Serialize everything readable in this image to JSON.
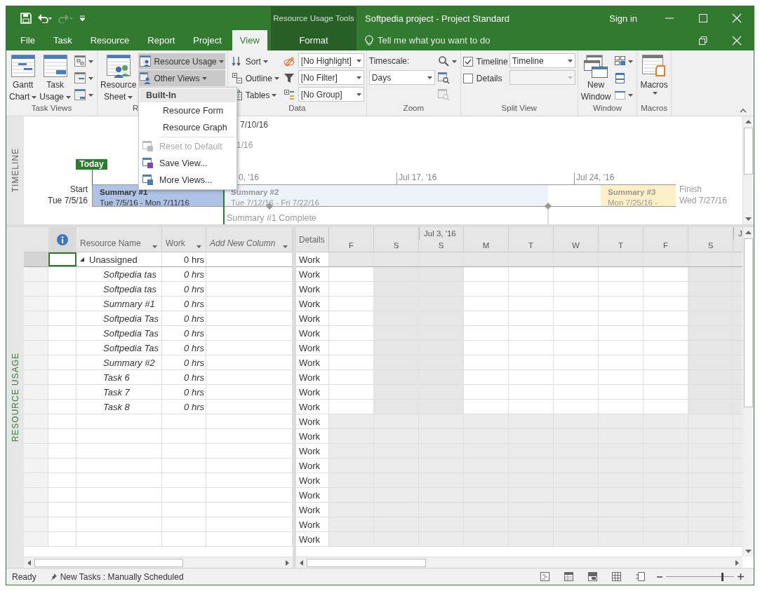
{
  "title_bar": {
    "context": "Resource Usage Tools",
    "title": "Softpedia project - Project Standard",
    "sign_in": "Sign in"
  },
  "tabs": [
    {
      "label": "File",
      "selected": false,
      "kind": "standard"
    },
    {
      "label": "Task",
      "selected": false,
      "kind": "standard"
    },
    {
      "label": "Resource",
      "selected": false,
      "kind": "standard"
    },
    {
      "label": "Report",
      "selected": false,
      "kind": "standard"
    },
    {
      "label": "Project",
      "selected": false,
      "kind": "standard"
    },
    {
      "label": "View",
      "selected": true,
      "kind": "standard"
    },
    {
      "label": "Format",
      "selected": false,
      "kind": "contextual"
    }
  ],
  "tell_me": {
    "placeholder": "Tell me what you want to do"
  },
  "ribbon": [
    {
      "label": "Task Views",
      "label_cut": false,
      "columns": [
        [
          {
            "kind": "large",
            "lines": [
              "Gantt",
              "Chart"
            ],
            "dropdown": true
          }
        ],
        [
          {
            "kind": "large",
            "lines": [
              "Task",
              "Usage"
            ],
            "dropdown": true
          }
        ],
        [
          {
            "kind": "icon",
            "dropdown": true,
            "disabled": false
          },
          {
            "kind": "icon",
            "dropdown": true,
            "disabled": false
          },
          {
            "kind": "icon",
            "dropdown": true,
            "disabled": false
          }
        ]
      ]
    },
    {
      "label": "R",
      "label_cut": true,
      "columns": [
        [
          {
            "kind": "large",
            "lines": [
              "Resource",
              "Sheet"
            ],
            "dropdown": true
          }
        ],
        [
          {
            "kind": "small",
            "label": "Resource Usage",
            "dropdown": true,
            "highlighted": true
          },
          {
            "kind": "small",
            "label": "Other Views",
            "dropdown": true,
            "highlighted": true
          }
        ]
      ]
    },
    {
      "label": "Data",
      "label_cut": false,
      "columns": [
        [
          {
            "kind": "small",
            "label": "Sort",
            "dropdown": true,
            "highlighted": false
          },
          {
            "kind": "small",
            "label": "Outline",
            "dropdown": true,
            "highlighted": false
          },
          {
            "kind": "small",
            "label": "Tables",
            "dropdown": true,
            "highlighted": false
          }
        ],
        [
          {
            "kind": "icon",
            "dropdown": false,
            "disabled": false
          },
          {
            "kind": "icon",
            "dropdown": false,
            "disabled": false
          },
          {
            "kind": "icon",
            "dropdown": false,
            "disabled": false
          }
        ],
        [
          {
            "kind": "combo",
            "value": "[No Highlight]",
            "disabled": false
          },
          {
            "kind": "combo",
            "value": "[No Filter]",
            "disabled": false
          },
          {
            "kind": "combo",
            "value": "[No Group]",
            "disabled": false
          }
        ]
      ]
    },
    {
      "label": "Zoom",
      "label_cut": false,
      "columns": [
        [
          {
            "kind": "text",
            "label": "Timescale:"
          },
          {
            "kind": "combo",
            "value": "Days",
            "disabled": false
          }
        ],
        [
          {
            "kind": "icon",
            "dropdown": true,
            "disabled": false
          },
          {
            "kind": "icon",
            "dropdown": false,
            "disabled": false
          },
          {
            "kind": "icon",
            "dropdown": false,
            "disabled": true
          }
        ]
      ]
    },
    {
      "label": "Split View",
      "label_cut": false,
      "columns": [
        [
          {
            "kind": "checkbox",
            "label": "Timeline",
            "checked": true
          },
          {
            "kind": "checkbox",
            "label": "Details",
            "checked": false
          }
        ],
        [
          {
            "kind": "combo",
            "value": "Timeline",
            "disabled": false
          },
          {
            "kind": "combo",
            "disabled": true
          }
        ]
      ]
    },
    {
      "label": "Window",
      "label_cut": false,
      "columns": [
        [
          {
            "kind": "large",
            "lines": [
              "New",
              "Window"
            ],
            "dropdown": false
          }
        ],
        [
          {
            "kind": "icon",
            "dropdown": true,
            "disabled": false
          },
          {
            "kind": "icon",
            "dropdown": false,
            "disabled": false
          },
          {
            "kind": "icon",
            "dropdown": true,
            "disabled": false
          }
        ]
      ]
    },
    {
      "label": "Macros",
      "label_cut": false,
      "columns": [
        [
          {
            "kind": "large",
            "lines": [
              "Macros"
            ],
            "dropdown": true
          }
        ]
      ]
    }
  ],
  "views_menu": {
    "header": "Built-In",
    "sections": [
      [
        {
          "label": "Resource Form",
          "disabled": false
        },
        {
          "label": "Resource Graph",
          "disabled": false
        }
      ],
      [
        {
          "label": "Reset to Default",
          "disabled": true
        },
        {
          "label": "Save View...",
          "disabled": false
        },
        {
          "label": "More Views...",
          "disabled": false
        }
      ]
    ]
  },
  "timeline": {
    "label": "TIMELINE",
    "dates": [
      "7/10/16",
      "1/16"
    ],
    "today": "Today",
    "start": {
      "label": "Start",
      "date": "Tue 7/5/16"
    },
    "finish": {
      "label": "Finish",
      "date": "Wed 7/27/16"
    },
    "ticks": [
      "0, '16",
      "Jul 17, '16",
      "Jul 24, '16"
    ],
    "bars": [
      {
        "name": "Summary #1",
        "dates": "Tue 7/5/16 - Mon 7/11/16",
        "color": "#aec3e6",
        "selected": true
      },
      {
        "name": "Summary #2",
        "dates": "Tue 7/12/16 - Fri 7/22/16",
        "color": "#eef3fa",
        "selected": false
      },
      {
        "name": "Summary #3",
        "dates": "Mon 7/25/16 -",
        "color": "#fdefc6",
        "selected": false
      }
    ],
    "milestone": "Summary #1 Complete"
  },
  "usage": {
    "label": "RESOURCE USAGE",
    "columns": [
      {
        "label": "Resource Name",
        "kind": "field"
      },
      {
        "label": "Work",
        "kind": "field"
      },
      {
        "label": "Add New Column",
        "kind": "add"
      }
    ],
    "details_header": "Details",
    "days": [
      {
        "label": "F",
        "nonworking": false
      },
      {
        "label": "S",
        "nonworking": true
      },
      {
        "label": "S",
        "week": "Jul 3, '16",
        "nonworking": true
      },
      {
        "label": "M",
        "nonworking": false
      },
      {
        "label": "T",
        "nonworking": false
      },
      {
        "label": "W",
        "nonworking": false
      },
      {
        "label": "T",
        "nonworking": false
      },
      {
        "label": "F",
        "nonworking": false
      },
      {
        "label": "S",
        "nonworking": true
      },
      {
        "week": "J",
        "nonworking": true
      }
    ],
    "rows": [
      {
        "kind": "resource",
        "name": "Unassigned",
        "work": "0 hrs",
        "expanded": true,
        "selected": true,
        "detail": "Work"
      },
      {
        "kind": "assignment",
        "name": "Softpedia tas",
        "work": "0 hrs",
        "selected": false,
        "detail": "Work"
      },
      {
        "kind": "assignment",
        "name": "Softpedia tas",
        "work": "0 hrs",
        "selected": false,
        "detail": "Work"
      },
      {
        "kind": "assignment",
        "name": "Summary #1",
        "work": "0 hrs",
        "selected": false,
        "detail": "Work"
      },
      {
        "kind": "assignment",
        "name": "Softpedia Tas",
        "work": "0 hrs",
        "selected": false,
        "detail": "Work"
      },
      {
        "kind": "assignment",
        "name": "Softpedia Tas",
        "work": "0 hrs",
        "selected": false,
        "detail": "Work"
      },
      {
        "kind": "assignment",
        "name": "Softpedia Tas",
        "work": "0 hrs",
        "selected": false,
        "detail": "Work"
      },
      {
        "kind": "assignment",
        "name": "Summary #2",
        "work": "0 hrs",
        "selected": false,
        "detail": "Work"
      },
      {
        "kind": "assignment",
        "name": "Task 6",
        "work": "0 hrs",
        "selected": false,
        "detail": "Work"
      },
      {
        "kind": "assignment",
        "name": "Task 7",
        "work": "0 hrs",
        "selected": false,
        "detail": "Work"
      },
      {
        "kind": "assignment",
        "name": "Task 8",
        "work": "0 hrs",
        "selected": false,
        "detail": "Work"
      },
      {
        "kind": "blank",
        "selected": false,
        "detail": "Work"
      },
      {
        "kind": "blank",
        "selected": false,
        "detail": "Work"
      },
      {
        "kind": "blank",
        "selected": false,
        "detail": "Work"
      },
      {
        "kind": "blank",
        "selected": false,
        "detail": "Work"
      },
      {
        "kind": "blank",
        "selected": false,
        "detail": "Work"
      },
      {
        "kind": "blank",
        "selected": false,
        "detail": "Work"
      },
      {
        "kind": "blank",
        "selected": false,
        "detail": "Work"
      },
      {
        "kind": "blank",
        "selected": false,
        "detail": "Work"
      },
      {
        "kind": "blank",
        "selected": false,
        "detail": "Work"
      }
    ]
  },
  "status_bar": {
    "status": "Ready",
    "new_tasks": "New Tasks : Manually Scheduled",
    "zoom": {
      "level": 0.82
    }
  }
}
